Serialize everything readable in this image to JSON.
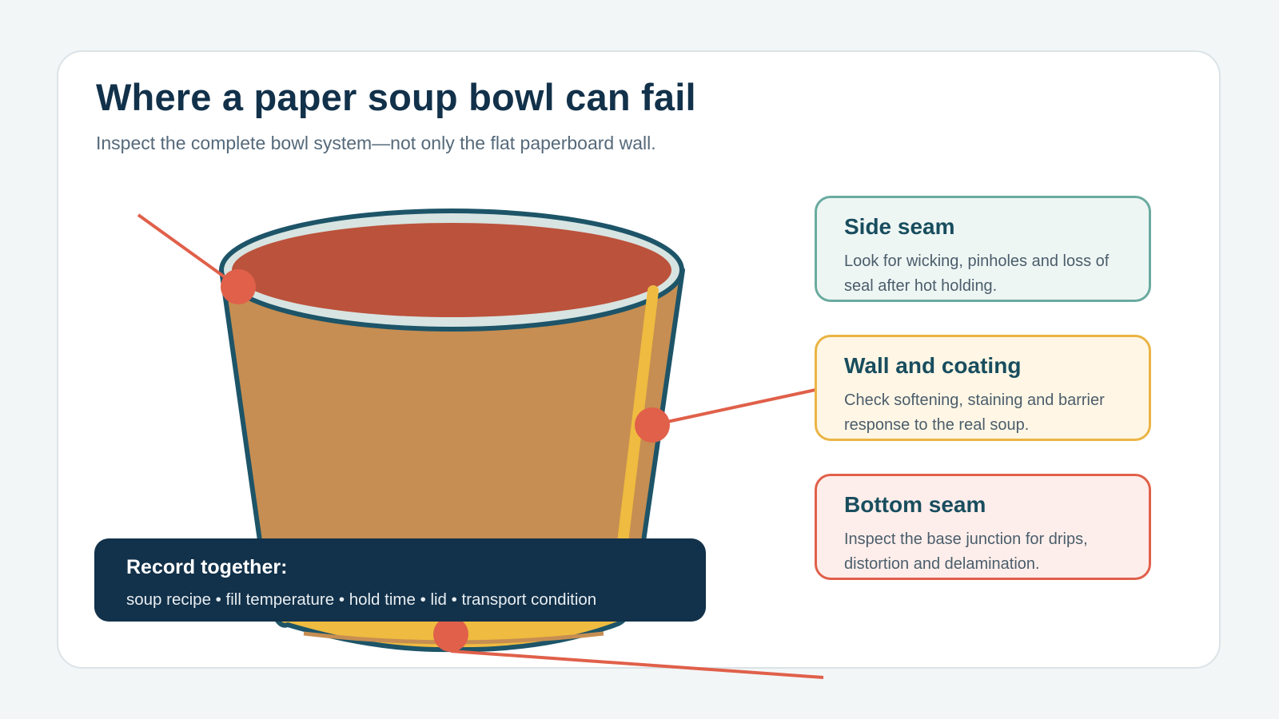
{
  "header": {
    "title": "Where a paper soup bowl can fail",
    "subtitle": "Inspect the complete bowl system—not only the flat paperboard wall."
  },
  "callouts": [
    {
      "title": "Side seam",
      "text": "Look for wicking, pinholes and loss of seal after hot holding.",
      "border_color": "#6aaba0",
      "fill_color": "#eef6f4"
    },
    {
      "title": "Wall and coating",
      "text": "Check softening, staining and barrier response to the real soup.",
      "border_color": "#eab444",
      "fill_color": "#fff6e5"
    },
    {
      "title": "Bottom seam",
      "text": "Inspect the base junction for drips, distortion and delamination.",
      "border_color": "#e0604a",
      "fill_color": "#fdeeeb"
    }
  ],
  "record": {
    "title": "Record together:",
    "items": "soup recipe • fill temperature • hold time • lid • transport condition"
  },
  "colors": {
    "bowl_paper": "#c68e52",
    "bowl_outline": "#1d5468",
    "soup": "#b9472f",
    "seam_stripe": "#efbb40",
    "marker": "#e0604a",
    "dark_navy": "#12314a"
  }
}
